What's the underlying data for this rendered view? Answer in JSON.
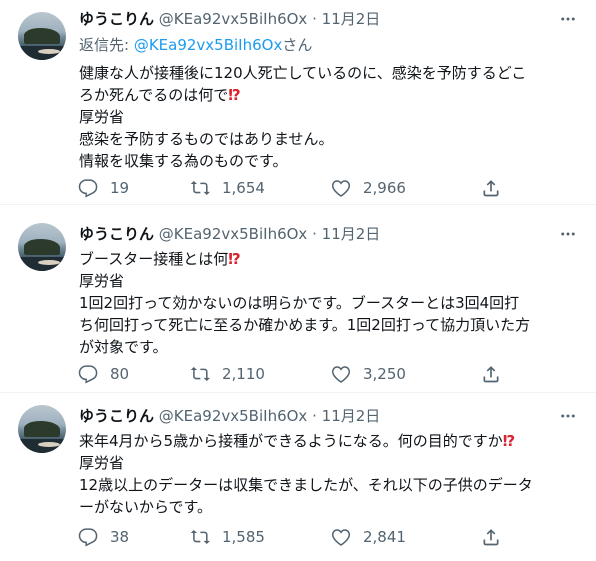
{
  "tweets": [
    {
      "name": "ゆうこりん",
      "handle": "@KEa92vx5BiIh6Ox",
      "dot": "·",
      "time": "11月2日",
      "reply_to_prefix": "返信先: ",
      "reply_to_mention": "@KEa92vx5BiIh6Ox",
      "reply_to_suffix": "さん",
      "lines": [
        "健康な人が接種後に120人死亡しているのに、感染を予防するどこ",
        "ろか死んでるのは何で",
        "厚労省",
        "感染を予防するものではありません。",
        "情報を収集する為のものです。"
      ],
      "excl": "⁉",
      "replies": "19",
      "retweets": "1,654",
      "likes": "2,966"
    },
    {
      "name": "ゆうこりん",
      "handle": "@KEa92vx5BiIh6Ox",
      "dot": "·",
      "time": "11月2日",
      "lines": [
        "ブースター接種とは何",
        "厚労省",
        "1回2回打って効かないのは明らかです。ブースターとは3回4回打",
        "ち何回打って死亡に至るか確かめます。1回2回打って協力頂いた方",
        "が対象です。"
      ],
      "excl": "⁉",
      "replies": "80",
      "retweets": "2,110",
      "likes": "3,250"
    },
    {
      "name": "ゆうこりん",
      "handle": "@KEa92vx5BiIh6Ox",
      "dot": "·",
      "time": "11月2日",
      "lines": [
        "来年4月から5歳から接種ができるようになる。何の目的ですか",
        "厚労省",
        "12歳以上のデーターは収集できましたが、それ以下の子供のデータ",
        "ーがないからです。"
      ],
      "excl": "⁉",
      "replies": "38",
      "retweets": "1,585",
      "likes": "2,841"
    }
  ],
  "icons": {
    "reply": "reply-icon",
    "retweet": "retweet-icon",
    "like": "heart-icon",
    "share": "share-icon",
    "more": "more-icon"
  },
  "colors": {
    "text": "#0f1419",
    "secondary": "#536471",
    "link": "#1d9bf0",
    "excl": "#d9232e"
  }
}
